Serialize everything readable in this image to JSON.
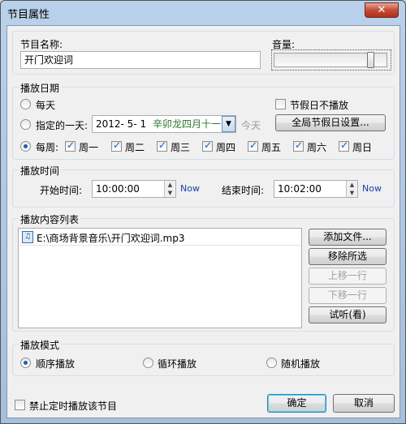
{
  "window": {
    "title": "节目属性",
    "close_label": "✕"
  },
  "program": {
    "name_label": "节目名称:",
    "name_value": "开门欢迎词",
    "volume_label": "音量:",
    "volume_level": 0.88
  },
  "date": {
    "group_label": "播放日期",
    "daily_label": "每天",
    "specific_label": "指定的一天:",
    "specific_date": "2012-  5-  1",
    "lunar_date": "辛卯龙四月十一",
    "today_link": "今天",
    "holiday_no_play_label": "节假日不播放",
    "global_holiday_button": "全局节假日设置...",
    "weekly_label": "每周:",
    "weekdays": [
      "周一",
      "周二",
      "周三",
      "周四",
      "周五",
      "周六",
      "周日"
    ]
  },
  "time": {
    "group_label": "播放时间",
    "start_label": "开始时间:",
    "start_value": "10:00:00",
    "start_now": "Now",
    "end_label": "结束时间:",
    "end_value": "10:02:00",
    "end_now": "Now"
  },
  "content": {
    "group_label": "播放内容列表",
    "files": [
      "E:\\商场背景音乐\\开门欢迎词.mp3"
    ],
    "add_button": "添加文件...",
    "remove_button": "移除所选",
    "up_button": "上移一行",
    "down_button": "下移一行",
    "preview_button": "试听(看)"
  },
  "mode": {
    "group_label": "播放模式",
    "sequential_label": "顺序播放",
    "loop_label": "循环播放",
    "random_label": "随机播放"
  },
  "footer": {
    "disable_label": "禁止定时播放该节目",
    "ok_button": "确定",
    "cancel_button": "取消"
  }
}
